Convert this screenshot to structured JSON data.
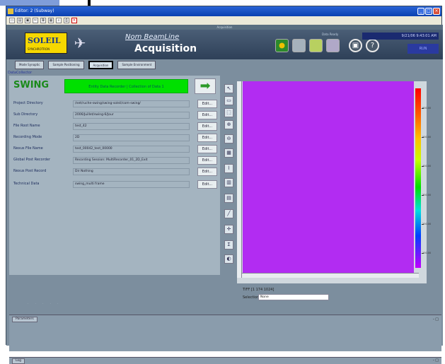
{
  "window": {
    "title": "Editor: 2 (Subway)",
    "controls": [
      "_",
      "□",
      "×"
    ]
  },
  "toolbar": {
    "icons": [
      "new-icon",
      "open-icon",
      "save-icon",
      "cut-icon",
      "copy-icon",
      "paste-icon",
      "find-icon",
      "print-icon",
      "close-icon"
    ]
  },
  "app": {
    "subtitle": "Acquisition",
    "logo_text": "SOLEIL",
    "logo_sub": "SYNCHROTRON",
    "beamline": "Nom BeamLine",
    "title": "Acquisition",
    "header_mini_label": "Data Ready",
    "datetime": "9/21/06 9:43:01 AM",
    "run_label": "RUN"
  },
  "tabs": [
    {
      "label": "Mode Synoptic",
      "active": false
    },
    {
      "label": "Sample Positioning",
      "active": false
    },
    {
      "label": "Acquisition",
      "active": true
    },
    {
      "label": "Sample Environment",
      "active": false
    }
  ],
  "datacollector_label": "DataCollector",
  "swing": {
    "label": "SWING",
    "status": "Entity Data Recorder | Collection of Data 1",
    "go_icon": "arrow-right-icon"
  },
  "fields": [
    {
      "label": "Project Directory",
      "value": "/net/ruche-swing/swing-soleil/com-swing/",
      "edit": "Edit..."
    },
    {
      "label": "Sub Directory",
      "value": "2006/Juillet/swing-6/Jour",
      "edit": "Edit..."
    },
    {
      "label": "File Root Name",
      "value": "test_42",
      "edit": "Edit..."
    },
    {
      "label": "Recording Mode",
      "value": "2D",
      "edit": "Edit..."
    },
    {
      "label": "Nexus File Name",
      "value": "test_00042_test_00000",
      "edit": "Edit..."
    },
    {
      "label": "Global Post Recorder",
      "value": "Recording Session: MultiRecorder_01_2D_Exit",
      "edit": "Edit..."
    },
    {
      "label": "Nexus Post Record",
      "value": "Dir Nothing",
      "edit": "Edit..."
    },
    {
      "label": "Technical Data",
      "value": "swing_multi frame",
      "edit": "Edit..."
    }
  ],
  "tools": [
    "cursor-icon",
    "rectangle-icon",
    "select-icon",
    "zoom-in-icon",
    "zoom-out-icon",
    "grid-icon",
    "profile-icon",
    "histogram-icon",
    "chart-icon",
    "line-icon",
    "cross-icon",
    "stats-icon",
    "palette-icon"
  ],
  "image": {
    "colorbar_labels": [
      "600.00",
      "500.00",
      "400.00",
      "300.00",
      "200.00",
      "100.00"
    ],
    "info": "TIFF [1 174 1024]",
    "selection_label": "Selection",
    "selection_value": "None"
  },
  "bottom": {
    "params_tab": "Parameters",
    "params_ctl": "- □",
    "log_tab": "Log",
    "log_ctl": "- □"
  },
  "colors": {
    "swing_green": "#00e000",
    "image_purple": "#b22cf2",
    "header_blue": "#2a64d6"
  }
}
